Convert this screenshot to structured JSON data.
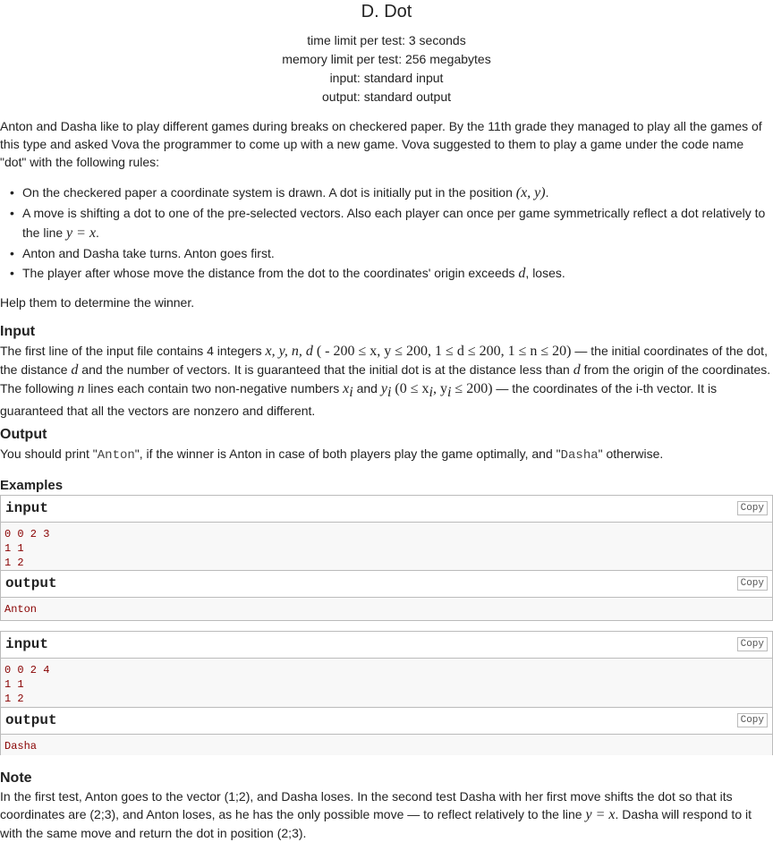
{
  "problem": {
    "title": "D. Dot",
    "time_limit": "time limit per test: 3 seconds",
    "memory_limit": "memory limit per test: 256 megabytes",
    "input_file": "input: standard input",
    "output_file": "output: standard output"
  },
  "statement": {
    "intro": "Anton and Dasha like to play different games during breaks on checkered paper. By the 11th grade they managed to play all the games of this type and asked Vova the programmer to come up with a new game. Vova suggested to them to play a game under the code name \"dot\" with the following rules:",
    "rule1_pre": "On the checkered paper a coordinate system is drawn. A dot is initially put in the position ",
    "rule1_math": "(x, y)",
    "rule1_post": ".",
    "rule2_pre": "A move is shifting a dot to one of the pre-selected vectors. Also each player can once per game symmetrically reflect a dot relatively to the line ",
    "rule2_math": "y = x",
    "rule2_post": ".",
    "rule3": "Anton and Dasha take turns. Anton goes first.",
    "rule4_pre": "The player after whose move the distance from the dot to the coordinates' origin exceeds ",
    "rule4_math": "d",
    "rule4_post": ", loses.",
    "help": "Help them to determine the winner."
  },
  "input_section": {
    "heading": "Input",
    "t1": "The first line of the input file contains 4 integers ",
    "m1": "x, y, n, d",
    "m2": " ( - 200 ≤ x, y ≤ 200, 1 ≤ d ≤ 200, 1 ≤ n ≤ 20)",
    "t2": " — the initial coordinates of the dot, the distance ",
    "m3": "d",
    "t3": " and the number of vectors. It is guaranteed that the initial dot is at the distance less than ",
    "m4": "d",
    "t4": " from the origin of the coordinates. The following ",
    "m5": "n",
    "t5": " lines each contain two non-negative numbers ",
    "m6": "x",
    "t6": " and ",
    "m7": "y",
    "m8": " (0 ≤ x",
    "m9": ", y",
    "m10": " ≤ 200)",
    "t7": " — the coordinates of the i-th vector. It is guaranteed that all the vectors are nonzero and different.",
    "sub_i": "i"
  },
  "output_section": {
    "heading": "Output",
    "t1": "You should print \"",
    "code1": "Anton",
    "t2": "\", if the winner is Anton in case of both players play the game optimally, and \"",
    "code2": "Dasha",
    "t3": "\" otherwise."
  },
  "examples": {
    "heading": "Examples",
    "input_label": "input",
    "output_label": "output",
    "copy_label": "Copy",
    "tests": [
      {
        "input": "0 0 2 3\n1 1\n1 2",
        "output": "Anton"
      },
      {
        "input": "0 0 2 4\n1 1\n1 2",
        "output": "Dasha"
      }
    ]
  },
  "note": {
    "heading": "Note",
    "t1": "In the first test, Anton goes to the vector (1;2), and Dasha loses. In the second test Dasha with her first move shifts the dot so that its coordinates are (2;3), and Anton loses, as he has the only possible move — to reflect relatively to the line ",
    "math": "y = x",
    "t2": ". Dasha will respond to it with the same move and return the dot in position (2;3)."
  }
}
